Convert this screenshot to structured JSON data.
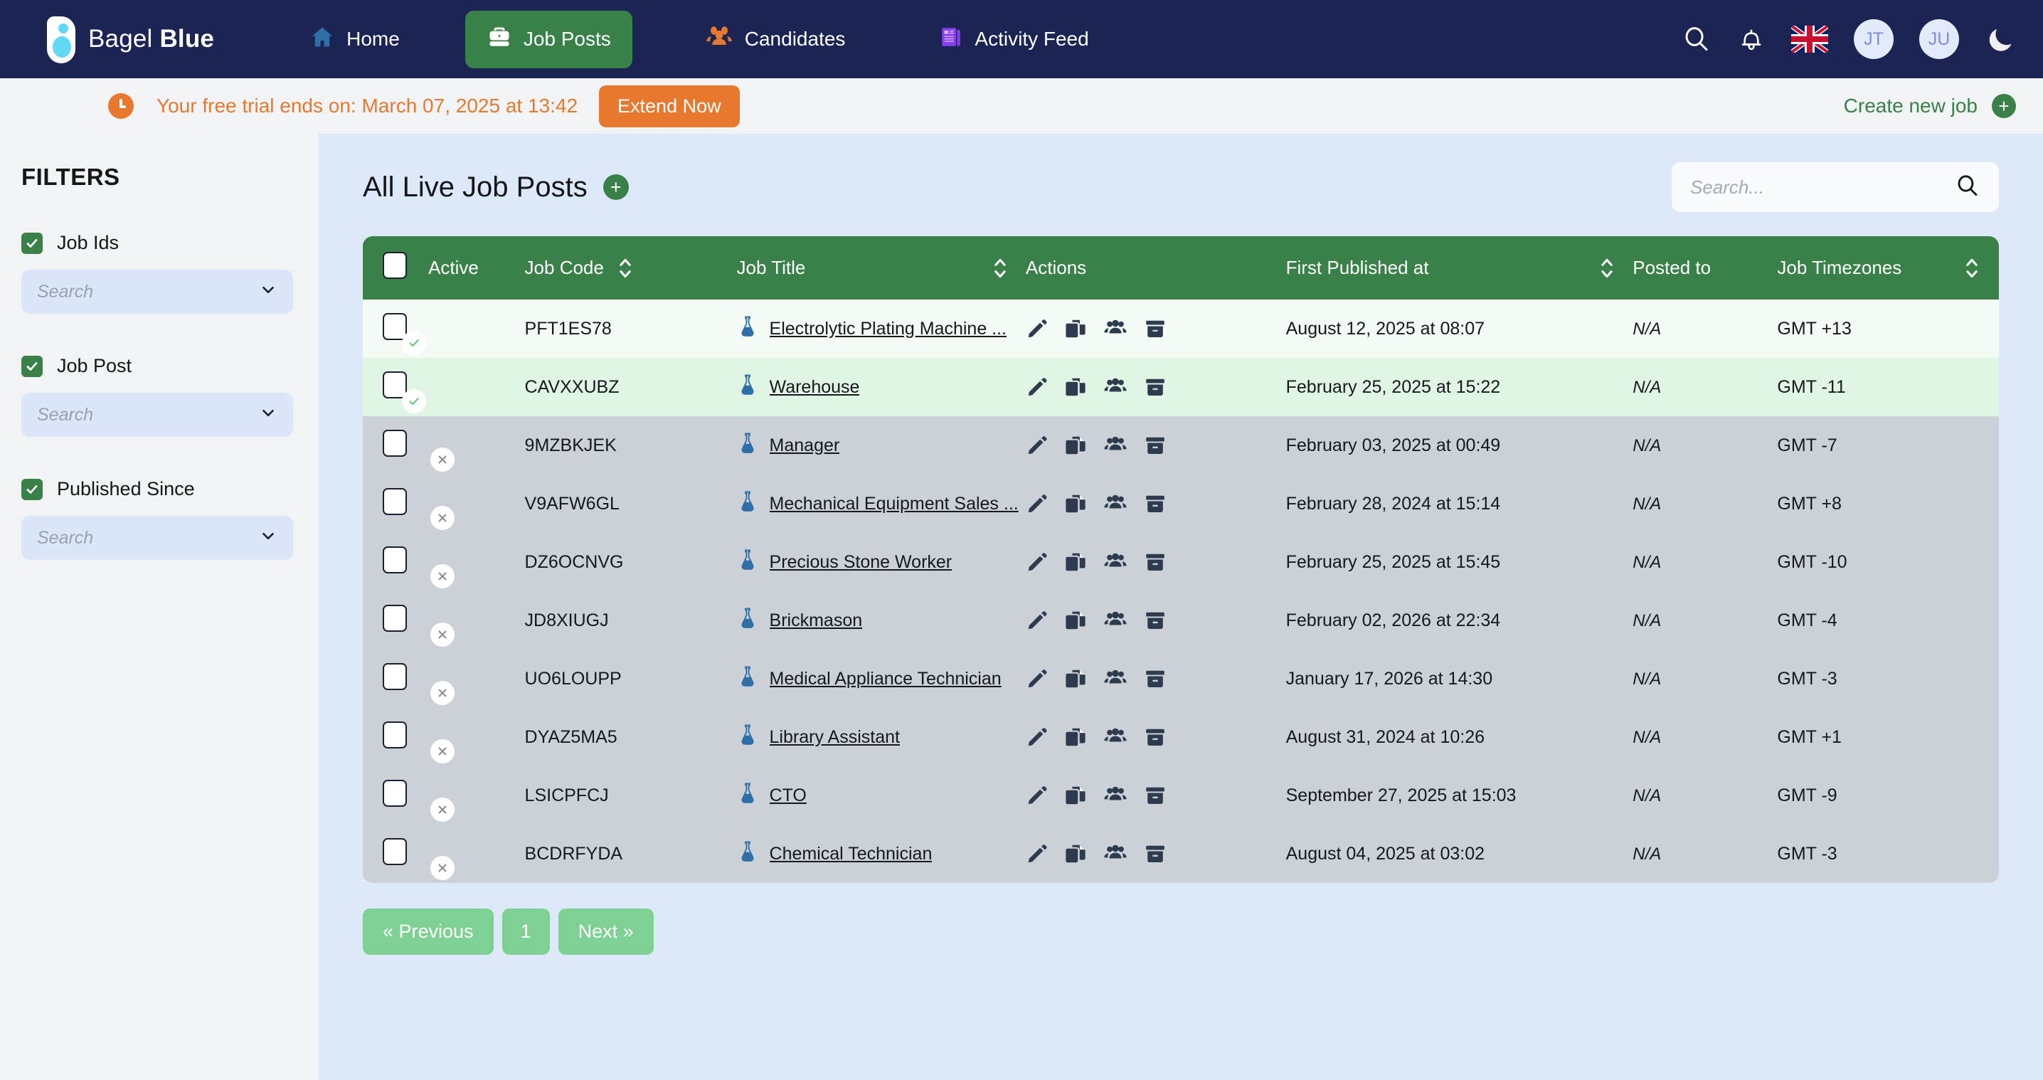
{
  "brand": {
    "name_light": "Bagel ",
    "name_bold": "Blue",
    "logo_icon": "bagel-logo-icon"
  },
  "nav": {
    "items": [
      {
        "label": "Home",
        "icon": "home-icon",
        "active": false
      },
      {
        "label": "Job Posts",
        "icon": "briefcase-icon",
        "active": true
      },
      {
        "label": "Candidates",
        "icon": "people-group-icon",
        "active": false
      },
      {
        "label": "Activity Feed",
        "icon": "newspaper-icon",
        "active": false
      }
    ],
    "search_icon": "search-icon",
    "bell_icon": "bell-icon",
    "flag_icon": "uk-flag-icon",
    "avatars": [
      "JT",
      "JU"
    ],
    "theme_icon": "moon-icon"
  },
  "banner": {
    "clock_icon": "clock-icon",
    "text": "Your free trial ends on: March 07, 2025 at 13:42",
    "extend_label": "Extend Now",
    "create_label": "Create new job",
    "create_icon": "plus-icon",
    "accent_color": "#e8782e"
  },
  "sidebar": {
    "title": "FILTERS",
    "groups": [
      {
        "label": "Job Ids",
        "checked": true,
        "placeholder": "Search",
        "value": ""
      },
      {
        "label": "Job Post",
        "checked": true,
        "placeholder": "Search",
        "value": ""
      },
      {
        "label": "Published Since",
        "checked": true,
        "placeholder": "Search",
        "value": ""
      }
    ]
  },
  "main": {
    "title": "All Live Job Posts",
    "add_icon": "plus-icon",
    "search": {
      "placeholder": "Search...",
      "value": "",
      "icon": "search-icon"
    }
  },
  "table": {
    "headers": [
      {
        "label": "Active",
        "sortable": false
      },
      {
        "label": "Job Code",
        "sortable": true
      },
      {
        "label": "Job Title",
        "sortable": true
      },
      {
        "label": "Actions",
        "sortable": false
      },
      {
        "label": "First Published at",
        "sortable": true
      },
      {
        "label": "Posted to",
        "sortable": false
      },
      {
        "label": "Job Timezones",
        "sortable": true
      }
    ],
    "action_icons": [
      "edit-pencil-icon",
      "duplicate-icon",
      "candidates-icon",
      "archive-icon"
    ],
    "title_icon": "flask-icon",
    "rows": [
      {
        "selected": false,
        "active": true,
        "code": "PFT1ES78",
        "title": "Electrolytic Plating Machine ...",
        "published": "August 12, 2025 at 08:07",
        "posted_to": "N/A",
        "timezone": "GMT +13",
        "tone": "green-light"
      },
      {
        "selected": false,
        "active": true,
        "code": "CAVXXUBZ",
        "title": "Warehouse",
        "published": "February 25, 2025 at 15:22",
        "posted_to": "N/A",
        "timezone": "GMT -11",
        "tone": "green"
      },
      {
        "selected": false,
        "active": false,
        "code": "9MZBKJEK",
        "title": "Manager",
        "published": "February 03, 2025 at 00:49",
        "posted_to": "N/A",
        "timezone": "GMT -7",
        "tone": "grey"
      },
      {
        "selected": false,
        "active": false,
        "code": "V9AFW6GL",
        "title": "Mechanical Equipment Sales ...",
        "published": "February 28, 2024 at 15:14",
        "posted_to": "N/A",
        "timezone": "GMT +8",
        "tone": "grey"
      },
      {
        "selected": false,
        "active": false,
        "code": "DZ6OCNVG",
        "title": "Precious Stone Worker",
        "published": "February 25, 2025 at 15:45",
        "posted_to": "N/A",
        "timezone": "GMT -10",
        "tone": "grey"
      },
      {
        "selected": false,
        "active": false,
        "code": "JD8XIUGJ",
        "title": "Brickmason",
        "published": "February 02, 2026 at 22:34",
        "posted_to": "N/A",
        "timezone": "GMT -4",
        "tone": "grey"
      },
      {
        "selected": false,
        "active": false,
        "code": "UO6LOUPP",
        "title": "Medical Appliance Technician",
        "published": "January 17, 2026 at 14:30",
        "posted_to": "N/A",
        "timezone": "GMT -3",
        "tone": "grey"
      },
      {
        "selected": false,
        "active": false,
        "code": "DYAZ5MA5",
        "title": "Library Assistant",
        "published": "August 31, 2024 at 10:26",
        "posted_to": "N/A",
        "timezone": "GMT +1",
        "tone": "grey"
      },
      {
        "selected": false,
        "active": false,
        "code": "LSICPFCJ",
        "title": "CTO",
        "published": "September 27, 2025 at 15:03",
        "posted_to": "N/A",
        "timezone": "GMT -9",
        "tone": "grey"
      },
      {
        "selected": false,
        "active": false,
        "code": "BCDRFYDA",
        "title": "Chemical Technician",
        "published": "August 04, 2025 at 03:02",
        "posted_to": "N/A",
        "timezone": "GMT -3",
        "tone": "grey"
      }
    ]
  },
  "pagination": {
    "previous": "« Previous",
    "pages": [
      "1"
    ],
    "next": "Next »",
    "current": "1"
  },
  "colors": {
    "navy": "#1b2453",
    "green": "#3a8049",
    "orange": "#e8782e",
    "page_bg": "#dde8f8",
    "toggle_on": "#63cb76",
    "toggle_off": "#f4a6a6"
  }
}
